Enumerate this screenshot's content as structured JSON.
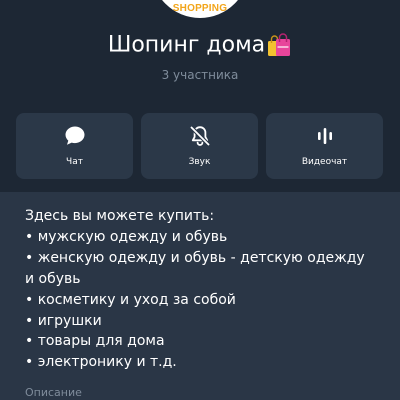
{
  "avatar": {
    "label": "SHOPPING"
  },
  "group": {
    "title": "Шопинг дома",
    "members": "3 участника"
  },
  "actions": [
    {
      "label": "Чат",
      "icon": "chat-bubble-icon"
    },
    {
      "label": "Звук",
      "icon": "bell-muted-icon"
    },
    {
      "label": "Видеочат",
      "icon": "audio-wave-icon"
    }
  ],
  "description": {
    "lines": [
      "Здесь вы можете купить:",
      "• мужскую одежду и обувь",
      "• женскую одежду и обувь - детскую одежду",
      "и обувь",
      "• косметику и уход за собой",
      "• игрушки",
      "• товары для дома",
      "• электронику и т.д."
    ],
    "caption": "Описание"
  },
  "colors": {
    "page_background": "#2a3646",
    "header_background": "#1d2734",
    "button_background": "#2b3848",
    "muted_text": "#7f8c9b",
    "bag_pink": "#e8459b",
    "avatar_orange": "#f2a51a"
  }
}
